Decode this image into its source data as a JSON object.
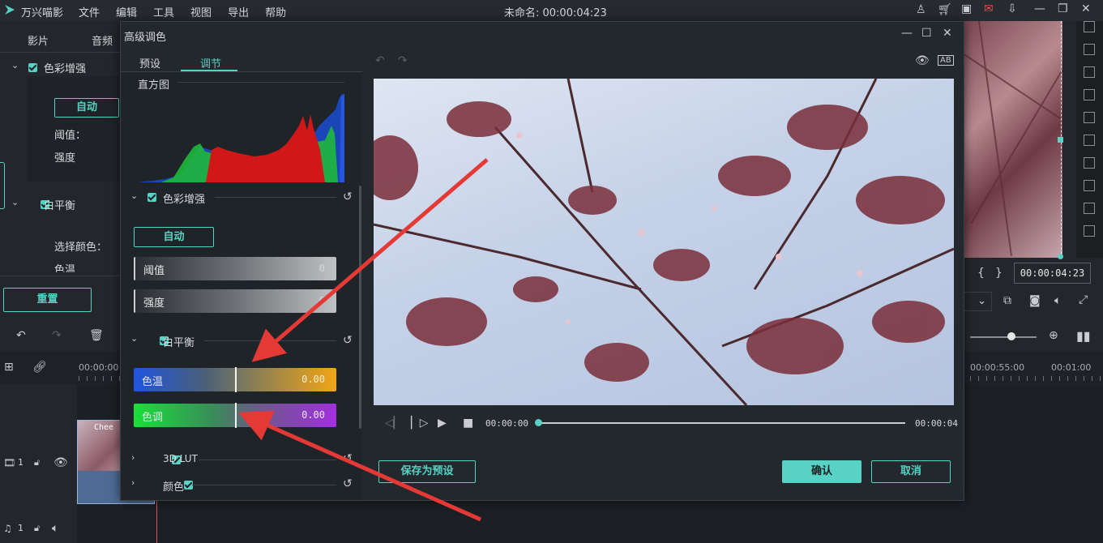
{
  "app": {
    "name": "万兴喵影",
    "menu": [
      "文件",
      "编辑",
      "工具",
      "视图",
      "导出",
      "帮助"
    ],
    "title": "未命名: 00:00:04:23"
  },
  "left_panel": {
    "tabs": [
      "影片",
      "音频"
    ],
    "color_enhance": {
      "label": "色彩增强",
      "auto": "自动",
      "threshold": "阈值：",
      "intensity": "强度"
    },
    "white_balance": {
      "label": "白平衡",
      "pick_color": "选择颜色：",
      "temp": "色温"
    },
    "reset": "重置"
  },
  "dialog": {
    "title": "高级调色",
    "tabs": [
      "预设",
      "调节"
    ],
    "active_tab": "调节",
    "histogram_label": "直方图",
    "color_enhance": {
      "label": "色彩增强",
      "auto": "自动",
      "threshold": {
        "label": "阈值",
        "value": "0"
      },
      "intensity": {
        "label": "强度",
        "value": "0"
      }
    },
    "white_balance": {
      "label": "白平衡",
      "temperature": {
        "label": "色温",
        "value": "0.00"
      },
      "tint": {
        "label": "色调",
        "value": "0.00"
      }
    },
    "lut": {
      "label": "3D LUT"
    },
    "color": {
      "label": "颜色"
    },
    "playback": {
      "current": "00:00:00",
      "end": "00:00:04",
      "progress": 0.0
    },
    "save_preset": "保存为预设",
    "confirm": "确认",
    "cancel": "取消"
  },
  "right_panel": {
    "timecode": "00:00:04:23"
  },
  "timeline": {
    "ruler": [
      "00:00:00",
      "00:00:55:00",
      "00:01:00"
    ],
    "clip_label": "Chee",
    "video_track": "1",
    "audio_track": "1"
  },
  "colors": {
    "accent": "#57d2c4",
    "arrow": "#e53935"
  }
}
